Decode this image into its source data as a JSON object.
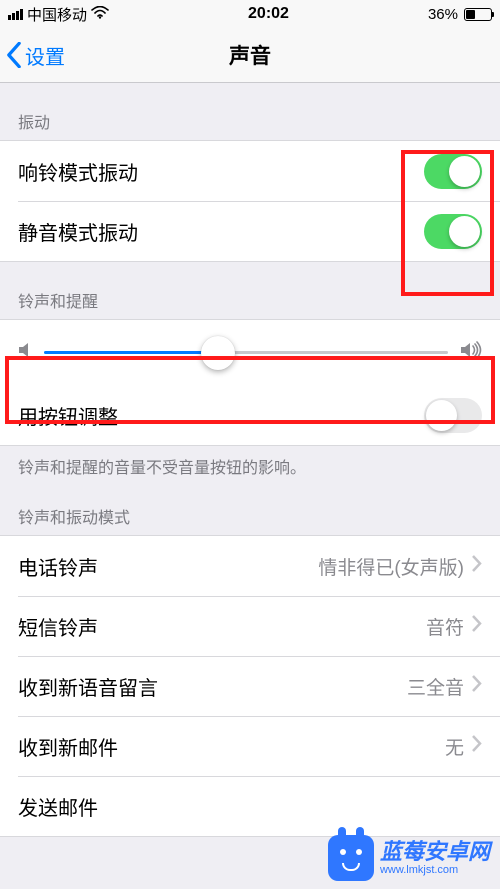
{
  "status_bar": {
    "carrier": "中国移动",
    "time": "20:02",
    "battery_percent": "36%"
  },
  "nav": {
    "back_label": "设置",
    "title": "声音"
  },
  "vibration": {
    "header": "振动",
    "ring_vibrate_label": "响铃模式振动",
    "ring_vibrate_on": true,
    "silent_vibrate_label": "静音模式振动",
    "silent_vibrate_on": true
  },
  "ringer": {
    "header": "铃声和提醒",
    "volume_percent": 43,
    "button_adjust_label": "用按钮调整",
    "button_adjust_on": false,
    "footer": "铃声和提醒的音量不受音量按钮的影响。"
  },
  "patterns": {
    "header": "铃声和振动模式",
    "items": [
      {
        "label": "电话铃声",
        "value": "情非得已(女声版)"
      },
      {
        "label": "短信铃声",
        "value": "音符"
      },
      {
        "label": "收到新语音留言",
        "value": "三全音"
      },
      {
        "label": "收到新邮件",
        "value": "无"
      },
      {
        "label": "发送邮件",
        "value": ""
      }
    ]
  },
  "watermark": {
    "title_cn": "蓝莓安卓网",
    "title_en": "www.lmkjst.com"
  }
}
